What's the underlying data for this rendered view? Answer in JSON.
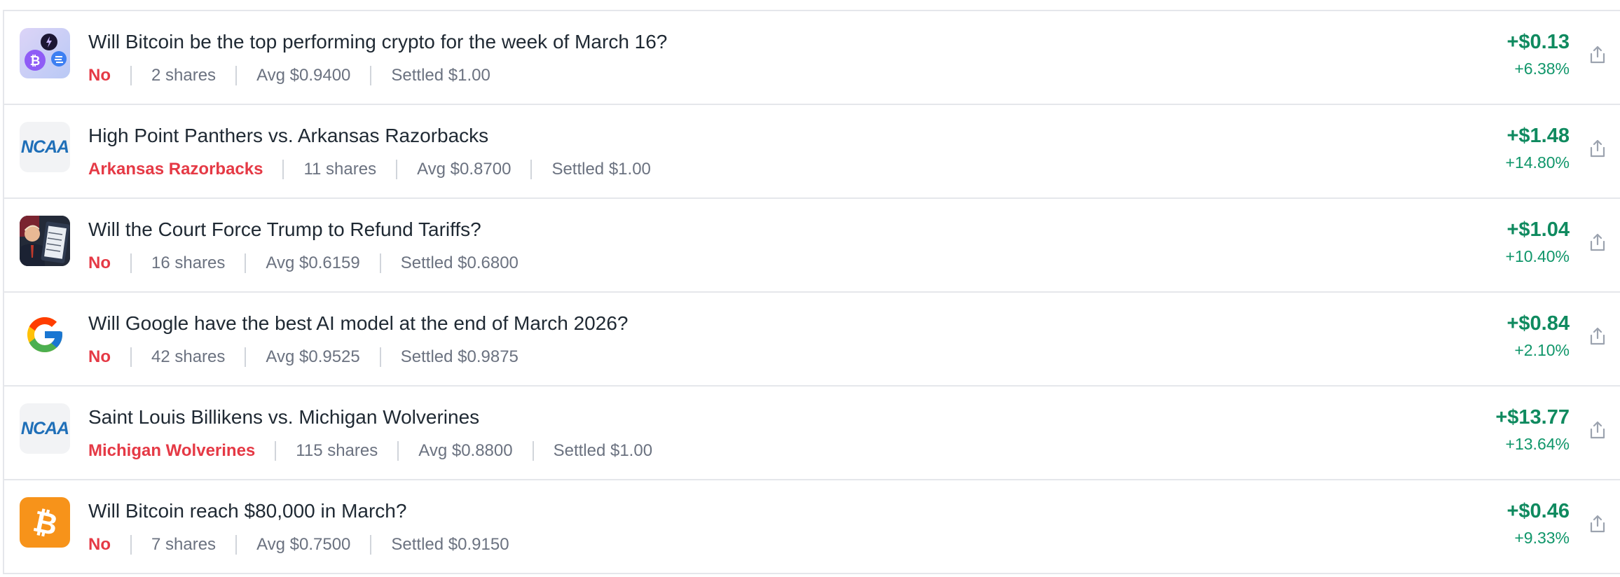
{
  "positions": [
    {
      "title": "Will Bitcoin be the top performing crypto for the week of March 16?",
      "outcome": "No",
      "shares": "2 shares",
      "avg": "Avg $0.9400",
      "settled": "Settled $1.00",
      "pnl": "+$0.13",
      "pnl_pct": "+6.38%",
      "icon": "crypto-coins-icon"
    },
    {
      "title": "High Point Panthers vs. Arkansas Razorbacks",
      "outcome": "Arkansas Razorbacks",
      "shares": "11 shares",
      "avg": "Avg $0.8700",
      "settled": "Settled $1.00",
      "pnl": "+$1.48",
      "pnl_pct": "+14.80%",
      "icon": "ncaa-logo",
      "logo_text": "NCAA"
    },
    {
      "title": "Will the Court Force Trump to Refund Tariffs?",
      "outcome": "No",
      "shares": "16 shares",
      "avg": "Avg $0.6159",
      "settled": "Settled $0.6800",
      "pnl": "+$1.04",
      "pnl_pct": "+10.40%",
      "icon": "trump-photo"
    },
    {
      "title": "Will Google have the best AI model at the end of March 2026?",
      "outcome": "No",
      "shares": "42 shares",
      "avg": "Avg $0.9525",
      "settled": "Settled $0.9875",
      "pnl": "+$0.84",
      "pnl_pct": "+2.10%",
      "icon": "google-logo"
    },
    {
      "title": "Saint Louis Billikens vs. Michigan Wolverines",
      "outcome": "Michigan Wolverines",
      "shares": "115 shares",
      "avg": "Avg $0.8800",
      "settled": "Settled $1.00",
      "pnl": "+$13.77",
      "pnl_pct": "+13.64%",
      "icon": "ncaa-logo",
      "logo_text": "NCAA"
    },
    {
      "title": "Will Bitcoin reach $80,000 in March?",
      "outcome": "No",
      "shares": "7 shares",
      "avg": "Avg $0.7500",
      "settled": "Settled $0.9150",
      "pnl": "+$0.46",
      "pnl_pct": "+9.33%",
      "icon": "bitcoin-logo"
    }
  ],
  "colors": {
    "outcome": "#e53945",
    "profit": "#0f8a5f",
    "divider": "#e5e7eb"
  }
}
